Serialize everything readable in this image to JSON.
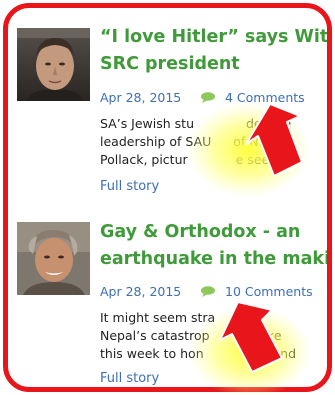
{
  "articles": [
    {
      "headline_lines": [
        "“I love Hitler” says Wits",
        "SRC president"
      ],
      "date": "Apr 28, 2015",
      "comments": "4 Comments",
      "excerpt_lines": [
        "SA’s Jewish stu",
        "der the",
        "leadership of SAU",
        "of Natan",
        "Pollack, pictur",
        "e seeking"
      ],
      "more": "Full story"
    },
    {
      "headline_lines": [
        "Gay & Orthodox - an",
        "earthquake in the making?"
      ],
      "date": "Apr 28, 2015",
      "comments": "10 Comments",
      "excerpt_lines": [
        "It might seem stra",
        "link",
        "Nepal’s catastrop",
        "quake",
        "this week to hon",
        "ality and"
      ],
      "more": "Full story"
    }
  ],
  "colors": {
    "frame": "#e8151b",
    "headline": "#3f9b3a",
    "link": "#3d6fb4",
    "arrow": "#e8151b",
    "glow": "#ffff33"
  },
  "icons": {
    "comment": "speech-bubble-icon",
    "annotation": "red-arrow-icon"
  }
}
